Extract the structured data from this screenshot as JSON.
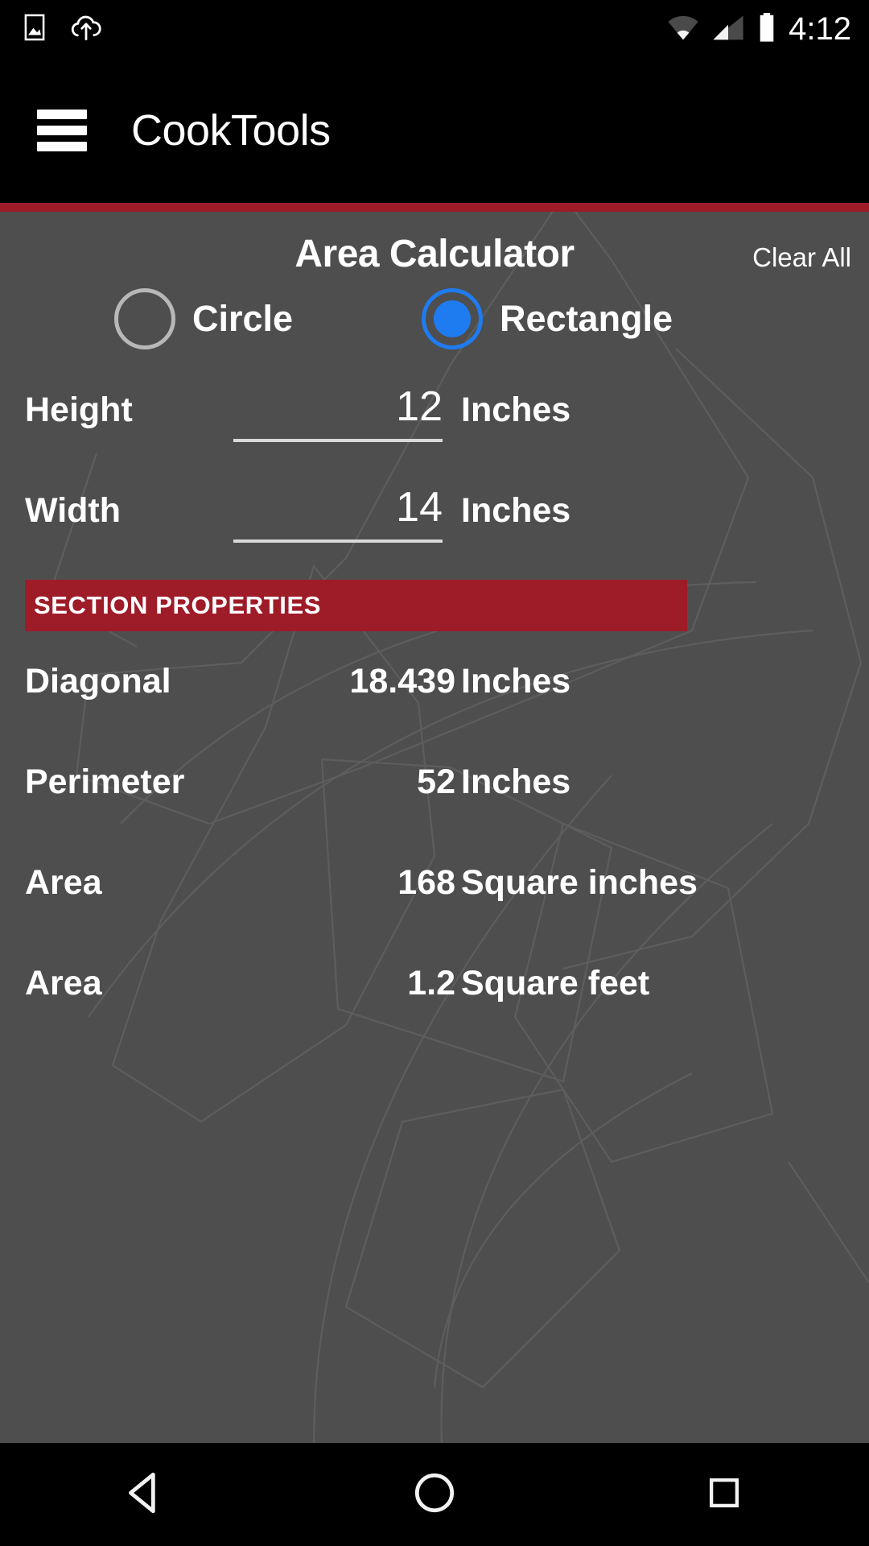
{
  "status_bar": {
    "time": "4:12",
    "icons": [
      "image-icon",
      "cloud-upload-icon",
      "wifi-icon",
      "cell-signal-icon",
      "battery-icon"
    ]
  },
  "app_bar": {
    "menu_icon": "hamburger-menu-icon",
    "title": "CookTools",
    "accent_color": "#9e1b28"
  },
  "screen": {
    "title": "Area Calculator",
    "clear_all_label": "Clear All",
    "background_color": "#4e4e4e"
  },
  "shape_selector": {
    "selected": "Rectangle",
    "options": [
      {
        "label": "Circle",
        "selected": false
      },
      {
        "label": "Rectangle",
        "selected": true
      }
    ],
    "selected_color": "#1f7bf0",
    "unselected_color": "#b8b8b8"
  },
  "inputs": [
    {
      "label": "Height",
      "value": "12",
      "unit": "Inches"
    },
    {
      "label": "Width",
      "value": "14",
      "unit": "Inches"
    }
  ],
  "section": {
    "header": "SECTION PROPERTIES",
    "header_color": "#9e1b28",
    "rows": [
      {
        "label": "Diagonal",
        "value": "18.439",
        "unit": "Inches"
      },
      {
        "label": "Perimeter",
        "value": "52",
        "unit": "Inches"
      },
      {
        "label": "Area",
        "value": "168",
        "unit": "Square inches"
      },
      {
        "label": "Area",
        "value": "1.2",
        "unit": "Square feet"
      }
    ]
  },
  "nav_bar": {
    "back_label": "Back",
    "home_label": "Home",
    "recents_label": "Recents"
  }
}
